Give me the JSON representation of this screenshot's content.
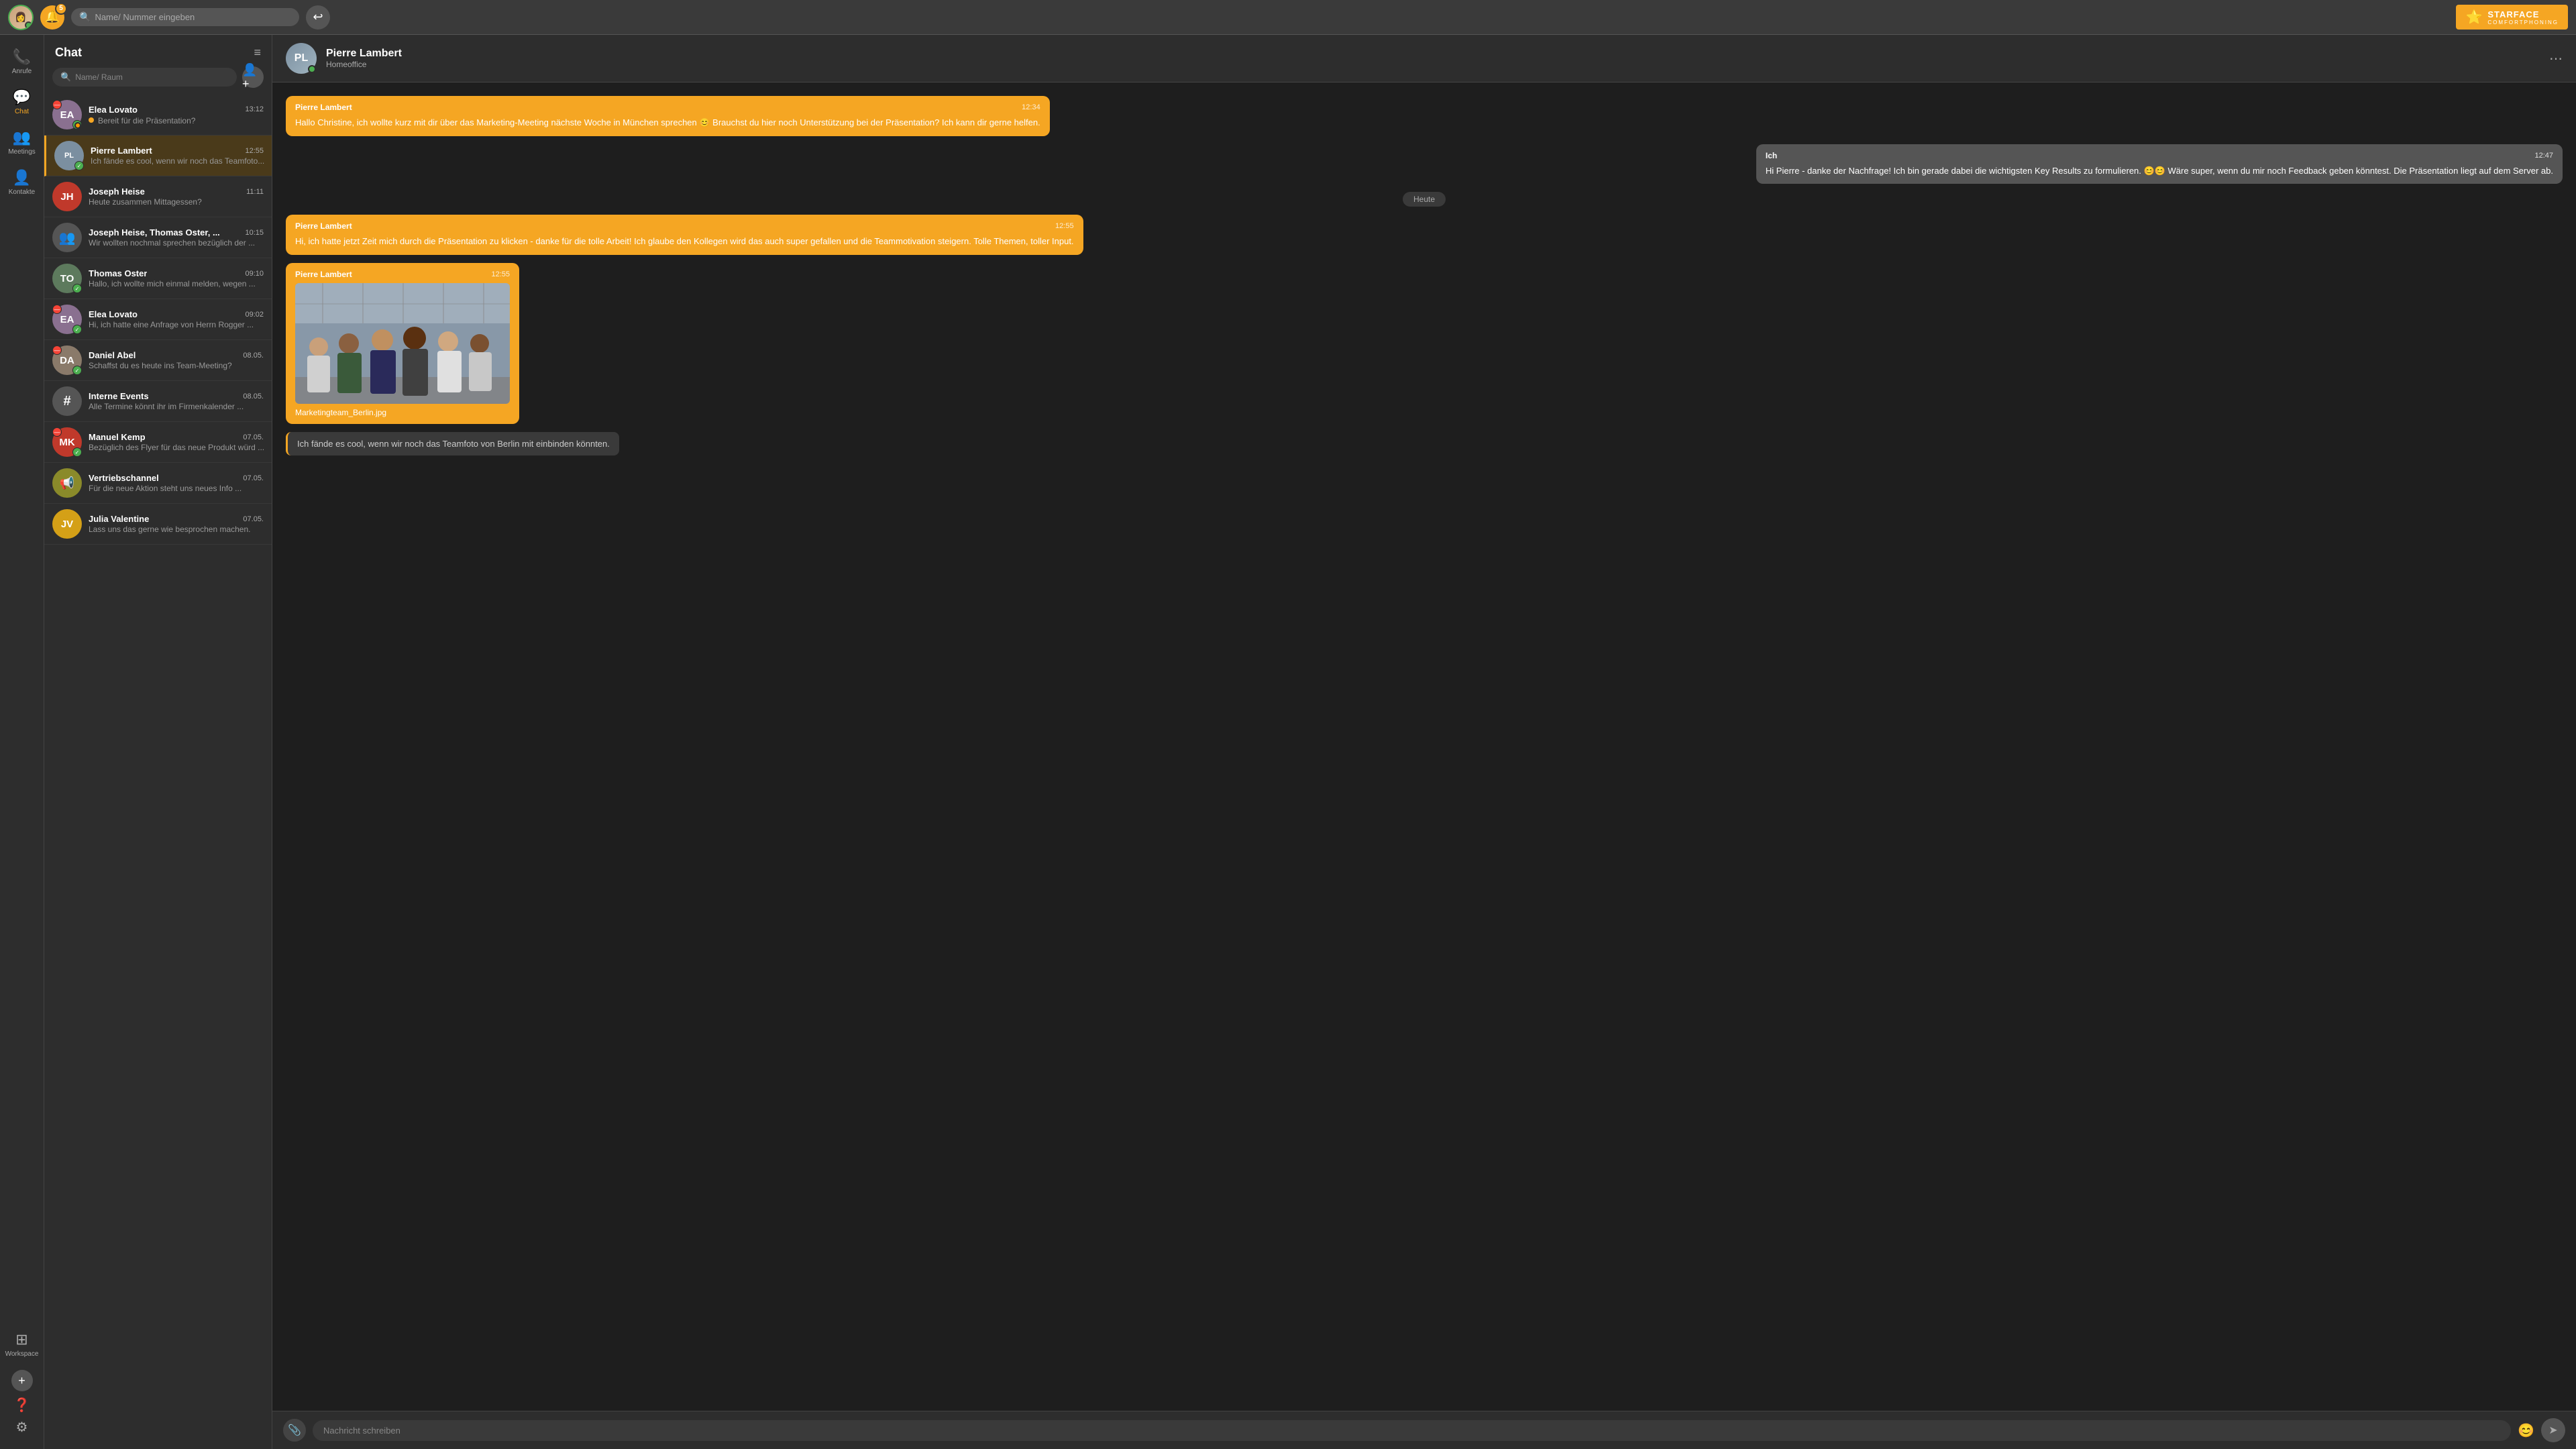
{
  "topbar": {
    "search_placeholder": "Name/ Nummer eingeben",
    "notif_count": "5",
    "logo_text": "STARFACE",
    "logo_sub": "COMFORTPHONING"
  },
  "sidebar": {
    "items": [
      {
        "id": "anrufe",
        "label": "Anrufe",
        "icon": "📞",
        "active": false
      },
      {
        "id": "chat",
        "label": "Chat",
        "icon": "💬",
        "active": true
      },
      {
        "id": "meetings",
        "label": "Meetings",
        "icon": "👥",
        "active": false
      },
      {
        "id": "kontakte",
        "label": "Kontakte",
        "icon": "👤",
        "active": false
      },
      {
        "id": "workspace",
        "label": "Workspace",
        "icon": "⊞",
        "active": false
      }
    ]
  },
  "chat_list": {
    "title": "Chat",
    "search_placeholder": "Name/ Raum",
    "items": [
      {
        "id": 1,
        "name": "Elea Lovato",
        "preview": "Bereit für die Präsentation?",
        "time": "13:12",
        "avatar_color": "#c0392b",
        "has_remove": true,
        "has_check": true,
        "status": "away",
        "unread": true
      },
      {
        "id": 2,
        "name": "Pierre Lambert",
        "preview": "Ich fände es cool, wenn wir noch das Teamfoto...",
        "time": "12:55",
        "avatar_color": "#7b8fa0",
        "has_check": true,
        "active": true
      },
      {
        "id": 3,
        "name": "Joseph Heise",
        "preview": "Heute zusammen Mittagessen?",
        "time": "11:11",
        "avatar_color": "#c0392b",
        "avatar_text": "JH"
      },
      {
        "id": 4,
        "name": "Joseph Heise, Thomas Oster, ...",
        "preview": "Wir wollten nochmal sprechen bezüglich der ...",
        "time": "10:15",
        "avatar_color": "#555",
        "is_group": true
      },
      {
        "id": 5,
        "name": "Thomas Oster",
        "preview": "Hallo, ich wollte mich einmal melden, wegen ...",
        "time": "09:10",
        "avatar_color": "#5d7a5d",
        "has_check": true
      },
      {
        "id": 6,
        "name": "Elea Lovato",
        "preview": "Hi, ich hatte eine Anfrage von Herrn Rogger ...",
        "time": "09:02",
        "avatar_color": "#c0392b",
        "has_remove": true,
        "has_check": true
      },
      {
        "id": 7,
        "name": "Daniel Abel",
        "preview": "Schaffst du es heute ins Team-Meeting?",
        "time": "08.05.",
        "avatar_color": "#8a7a6a",
        "has_remove": true,
        "has_check": true
      },
      {
        "id": 8,
        "name": "Interne Events",
        "preview": "Alle Termine könnt ihr im Firmenkalender ...",
        "time": "08.05.",
        "avatar_color": "#555",
        "is_hash": true
      },
      {
        "id": 9,
        "name": "Manuel Kemp",
        "preview": "Bezüglich des Flyer für das neue Produkt würd ...",
        "time": "07.05.",
        "avatar_color": "#c0392b",
        "has_remove": true,
        "has_check": true
      },
      {
        "id": 10,
        "name": "Vertriebschannel",
        "preview": "Für die neue Aktion steht uns neues Info ...",
        "time": "07.05.",
        "avatar_color": "#8a8a2a",
        "is_channel": true
      },
      {
        "id": 11,
        "name": "Julia Valentine",
        "preview": "Lass uns das gerne wie besprochen machen.",
        "time": "07.05.",
        "avatar_color": "#d4a017"
      }
    ]
  },
  "chat_main": {
    "contact_name": "Pierre Lambert",
    "contact_status": "Homeoffice",
    "messages": [
      {
        "id": 1,
        "sender": "Pierre Lambert",
        "time": "12:34",
        "text": "Hallo Christine, ich wollte kurz mit dir über das Marketing-Meeting nächste Woche in München sprechen 😊 Brauchst du hier noch Unterstützung bei der Präsentation? Ich kann dir gerne helfen.",
        "from_me": false
      },
      {
        "id": 2,
        "sender": "Ich",
        "time": "12:47",
        "text": "Hi Pierre - danke der Nachfrage! Ich bin gerade dabei die wichtigsten Key Results zu formulieren. 😊😊 Wäre super, wenn du mir noch Feedback geben könntest. Die Präsentation liegt auf dem Server ab.",
        "from_me": true
      },
      {
        "id": 3,
        "type": "date_divider",
        "label": "Heute"
      },
      {
        "id": 4,
        "sender": "Pierre Lambert",
        "time": "12:55",
        "text": "Hi, ich hatte jetzt Zeit mich durch die Präsentation zu klicken - danke für die tolle Arbeit! Ich glaube den Kollegen wird das auch super gefallen und die Teammotivation steigern. Tolle Themen, toller Input.",
        "from_me": false
      },
      {
        "id": 5,
        "sender": "Pierre Lambert",
        "time": "12:55",
        "type": "image",
        "image_caption": "Marketingteam_Berlin.jpg",
        "from_me": false
      },
      {
        "id": 6,
        "type": "draft",
        "text": "Ich fände es cool, wenn wir noch das Teamfoto von Berlin mit einbinden könnten."
      }
    ],
    "input_placeholder": "Nachricht schreiben"
  }
}
